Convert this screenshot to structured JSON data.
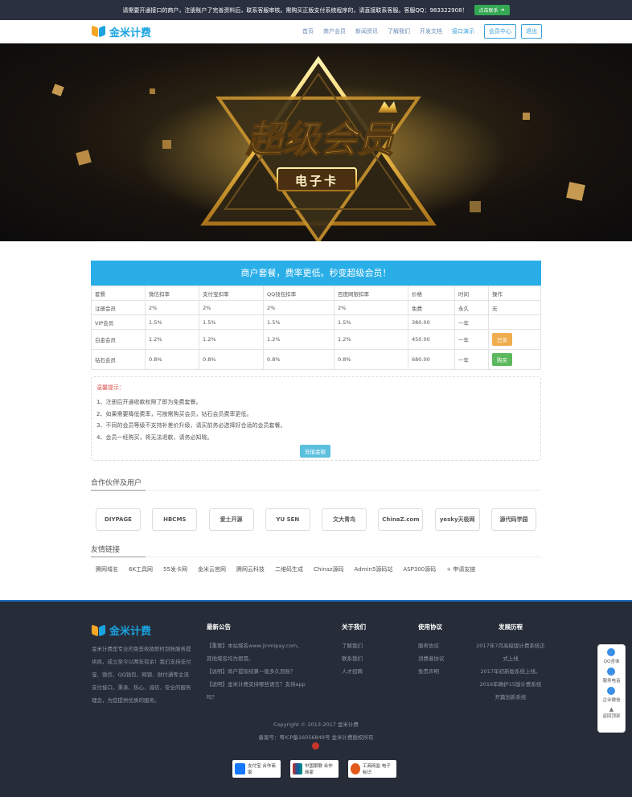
{
  "topbar": {
    "notice": "请需要开通接口的商户，注册账户了完善资料后，联系客服审核。需购买正版支付系统程序的，请直接联系客服。客服QQ：983322908！",
    "cta": "点击联系"
  },
  "header": {
    "logo_text": "金米计费",
    "nav": [
      "首页",
      "商户会员",
      "新闻资讯",
      "了解我们",
      "开发文档",
      "接口演示"
    ],
    "member_center": "会员中心",
    "logout": "退出"
  },
  "hero": {
    "title": "超级会员",
    "subtitle": "电子卡"
  },
  "packages": {
    "title": "商户套餐，费率更低。秒变超级会员！",
    "columns": [
      "套餐",
      "微信扣率",
      "支付宝扣率",
      "QQ钱包扣率",
      "百度网银扣率",
      "价格",
      "时间",
      "操作"
    ],
    "rows": [
      {
        "name": "注册会员",
        "wx": "2%",
        "ali": "2%",
        "qq": "2%",
        "bd": "2%",
        "price": "免费",
        "time": "永久",
        "op": "无"
      },
      {
        "name": "VIP会员",
        "wx": "1.5%",
        "ali": "1.5%",
        "qq": "1.5%",
        "bd": "1.5%",
        "price": "380.00",
        "time": "一年",
        "op": ""
      },
      {
        "name": "白金会员",
        "wx": "1.2%",
        "ali": "1.2%",
        "qq": "1.2%",
        "bd": "1.2%",
        "price": "450.00",
        "time": "一年",
        "op": "已买"
      },
      {
        "name": "钻石会员",
        "wx": "0.8%",
        "ali": "0.8%",
        "qq": "0.8%",
        "bd": "0.8%",
        "price": "680.00",
        "time": "一年",
        "op": "购买"
      }
    ]
  },
  "tips": {
    "title": "温馨提示：",
    "items": [
      "1、注册后开通收款权限了即为免费套餐。",
      "2、如果需要降低费率，可按需购买会员，钻石会员费率更低。",
      "3、不同的会员等级不支持补差价升级，请买前务必选择好合适的会员套餐。",
      "4、会员一经购买，将无法退款，请务必知晓。"
    ],
    "charge_btn": "充值金额"
  },
  "partners": {
    "title": "合作伙伴及用户",
    "items": [
      "DIYPAGE",
      "HBCMS",
      "爱土开源",
      "YU SEN",
      "文大青鸟",
      "ChinaZ.com",
      "yesky天极网",
      "源代码学园"
    ]
  },
  "friend_links": {
    "title": "友情链接",
    "items": [
      "腾网域名",
      "6K工具网",
      "55发卡网",
      "金米云官网",
      "腾网云科技",
      "二维码生成",
      "Chinaz源码",
      "Admin5源码站",
      "ASP300源码",
      "+ 申请友链"
    ]
  },
  "footer": {
    "logo_text": "金米计费",
    "about_text": "金米计费是专业的免签收款即时到账服务提供商，成立至今以两年有余！我们支持支付宝、微信、QQ钱包、网银、财付通等主流支付接口，秉承、热心、诚信、安全的服务理念，为您提供优质的服务。",
    "news_title": "最新公告",
    "news": [
      "【重要】本站域名www.jinmipay.com，其他域名均为假冒。",
      "【说明】商户提现结算一般多久到账？",
      "【说明】金米计费支持哪些语言？支持app吗？"
    ],
    "about_title": "关于我们",
    "about_links": [
      "了解我们",
      "联系我们",
      "人才招聘"
    ],
    "terms_title": "使用协议",
    "terms_links": [
      "服务协议",
      "消费者协议",
      "免责声明"
    ],
    "history_title": "发展历程",
    "history": [
      "2017年7月高级版计费系统正式上线",
      "2017年初新版系统上线。",
      "2016年确护15版计费系统",
      "开篇划新系统"
    ],
    "copyright": "Copyright © 2013-2017 金米计费",
    "icp": "备案号：粤ICP备16056849号 金米计费版权所有",
    "badges": [
      "支付宝 合作商家",
      "中国银联 合作商家",
      "工商网监 电子标识"
    ]
  },
  "sidebar": {
    "items": [
      "QQ咨询",
      "服务电话",
      "企业微信",
      "返回顶部"
    ]
  }
}
